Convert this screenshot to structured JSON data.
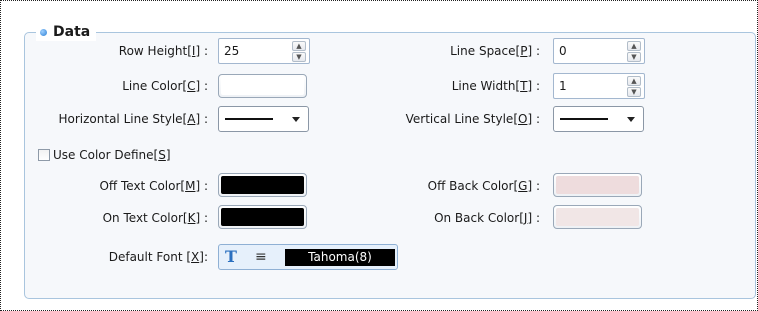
{
  "group": {
    "title": "Data"
  },
  "fields": {
    "row_height": {
      "label": "Row Height",
      "hotkey": "I",
      "value": "25"
    },
    "line_space": {
      "label": "Line Space",
      "hotkey": "P",
      "value": "0"
    },
    "line_color": {
      "label": "Line Color",
      "hotkey": "C",
      "color": "#ffffff"
    },
    "line_width": {
      "label": "Line Width",
      "hotkey": "T",
      "value": "1"
    },
    "horizontal_line_style": {
      "label": "Horizontal Line Style",
      "hotkey": "A"
    },
    "vertical_line_style": {
      "label": "Vertical Line Style",
      "hotkey": "O"
    },
    "use_color_define": {
      "label": "Use Color Define",
      "hotkey": "S",
      "checked": false
    },
    "off_text_color": {
      "label": "Off Text Color",
      "hotkey": "M",
      "color": "#000000"
    },
    "off_back_color": {
      "label": "Off Back Color",
      "hotkey": "G",
      "color": "#eedcdd"
    },
    "on_text_color": {
      "label": "On Text Color",
      "hotkey": "K",
      "color": "#000000"
    },
    "on_back_color": {
      "label": "On Back Color",
      "hotkey": "J",
      "color": "#f1e6e6"
    },
    "default_font": {
      "label": "Default Font",
      "hotkey": "X",
      "value": "Tahoma(8)"
    }
  },
  "separator": ":",
  "icons": {
    "font": "font-T-icon",
    "align": "align-center-icon",
    "spin_up": "spin-up-icon",
    "spin_down": "spin-down-icon",
    "dropdown": "chevron-down-icon"
  }
}
